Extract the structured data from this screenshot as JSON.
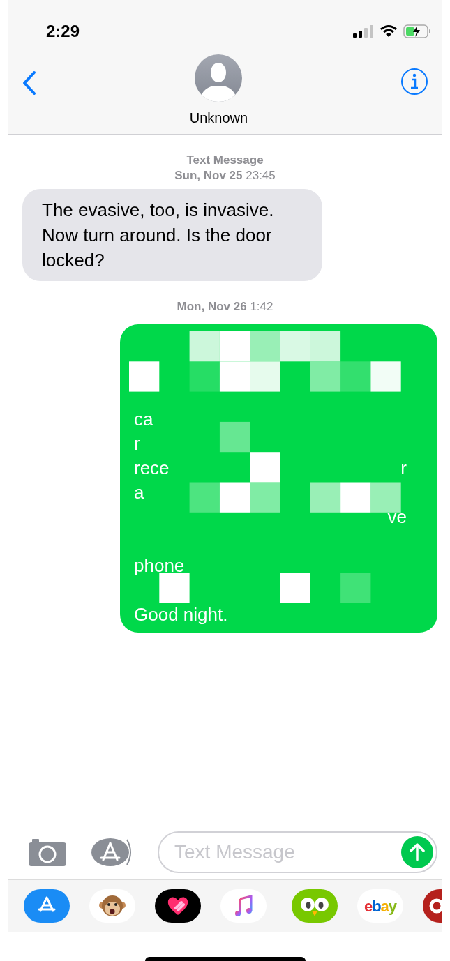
{
  "status_bar": {
    "time": "2:29"
  },
  "header": {
    "contact_name": "Unknown"
  },
  "messages": [
    {
      "kind": "timestamp",
      "label": "Text Message",
      "date": "**Sun, Nov 25** 23:45"
    },
    {
      "kind": "incoming",
      "text": "The evasive, too, is invasive. Now turn around. Is the door locked?"
    },
    {
      "kind": "timestamp",
      "date": "**Mon, Nov 26** 1:42"
    },
    {
      "kind": "outgoing",
      "censored": true,
      "lines": [
        {
          "kind": "hidden"
        },
        {
          "kind": "hidden"
        },
        {
          "kind": "hidden"
        },
        {
          "kind": "text",
          "left": "ca"
        },
        {
          "kind": "text",
          "left": "r"
        },
        {
          "kind": "text",
          "left": "rece",
          "right": "r"
        },
        {
          "kind": "text",
          "left": "a"
        },
        {
          "kind": "text",
          "right": "ve"
        },
        {
          "kind": "hidden"
        },
        {
          "kind": "text",
          "left": "phone"
        },
        {
          "kind": "hidden"
        },
        {
          "kind": "text",
          "left": "Good night."
        }
      ]
    }
  ],
  "composer": {
    "placeholder": "Text Message"
  },
  "app_drawer": [
    {
      "kind": "appstore"
    },
    {
      "kind": "monkey"
    },
    {
      "kind": "heart"
    },
    {
      "kind": "music"
    },
    {
      "kind": "owl"
    },
    {
      "kind": "ebay",
      "label": "ebay"
    },
    {
      "kind": "partial"
    }
  ]
}
